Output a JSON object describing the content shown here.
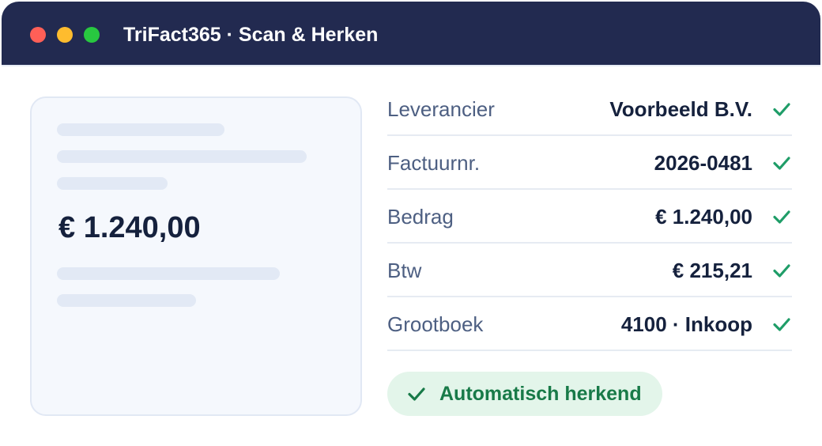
{
  "window": {
    "title": "TriFact365 · Scan & Herken",
    "controls": [
      "close",
      "minimize",
      "maximize"
    ]
  },
  "document_preview": {
    "amount": "€ 1.240,00"
  },
  "fields": [
    {
      "label": "Leverancier",
      "value": "Voorbeeld B.V.",
      "status": "check-icon"
    },
    {
      "label": "Factuurnr.",
      "value": "2026-0481",
      "status": "check-icon"
    },
    {
      "label": "Bedrag",
      "value": "€ 1.240,00",
      "status": "check-icon"
    },
    {
      "label": "Btw",
      "value": "€ 215,21",
      "status": "check-icon"
    },
    {
      "label": "Grootboek",
      "value": "4100 · Inkoop",
      "status": "check-icon"
    }
  ],
  "status_badge": {
    "icon": "check-icon",
    "label": "Automatisch herkend"
  },
  "colors": {
    "titlebar": "#222a50",
    "accent_green": "#1f9d68",
    "badge_background": "#e3f5ea",
    "badge_text": "#187a48",
    "value_text": "#15213d",
    "label_text": "#4d5f82"
  }
}
